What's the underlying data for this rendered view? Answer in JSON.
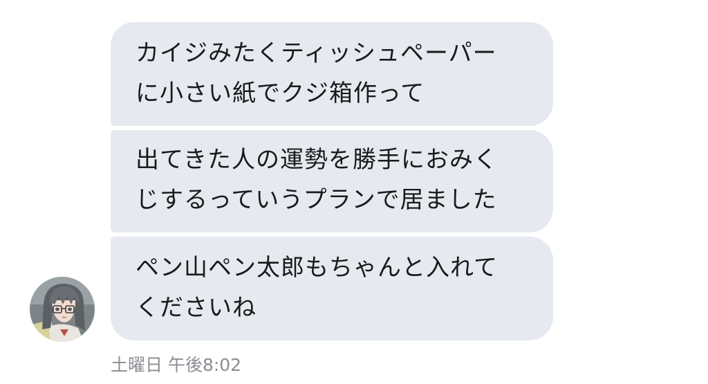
{
  "messages": [
    {
      "text": "カイジみたくティッシュペーパー\nに小さい紙でクジ箱作って"
    },
    {
      "text": "出てきた人の運勢を勝手におみく\nじするっていうプランで居ました"
    },
    {
      "text": "ペン山ペン太郎もちゃんと入れて\nくださいね"
    }
  ],
  "timestamp": "土曜日 午後8:02",
  "avatar": {
    "icon": "anime-girl-avatar"
  },
  "colors": {
    "bubble": "#e6e9ef",
    "text": "#1a1a1a",
    "timestamp": "#8a8d93"
  }
}
